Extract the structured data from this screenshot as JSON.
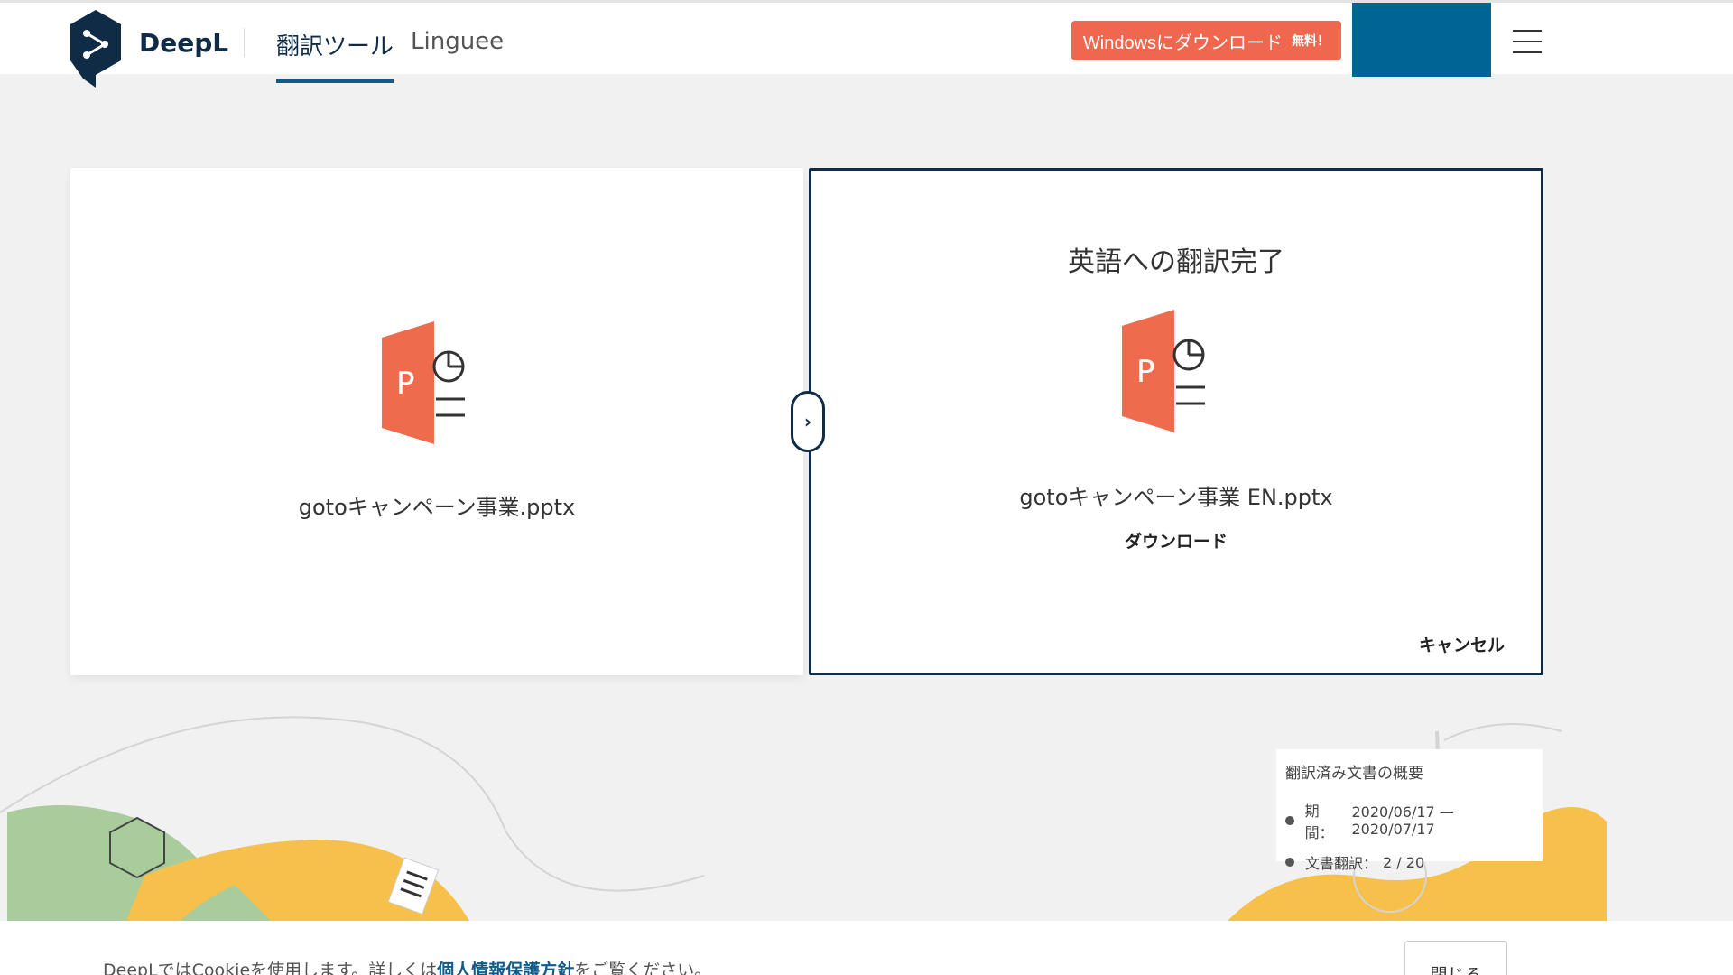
{
  "header": {
    "brand": "DeepL",
    "tabs": [
      {
        "label": "翻訳ツール",
        "active": true
      },
      {
        "label": "Linguee",
        "active": false
      }
    ],
    "download_button": {
      "label": "Windowsにダウンロード",
      "badge": "無料！"
    },
    "menu_icon": "hamburger-icon"
  },
  "source_panel": {
    "file_icon": "powerpoint-icon",
    "filename": "gotoキャンペーン事業.pptx"
  },
  "result_panel": {
    "title": "英語への翻訳完了",
    "file_icon": "powerpoint-icon",
    "filename": "gotoキャンペーン事業 EN.pptx",
    "download_label": "ダウンロード",
    "cancel_label": "キャンセル"
  },
  "toggle": {
    "symbol": "›"
  },
  "summary": {
    "title": "翻訳済み文書の概要",
    "period_label": "期間：",
    "period_value": "2020/06/17 — 2020/07/17",
    "docs_label": "文書翻訳：",
    "docs_value": "2 / 20"
  },
  "cookie": {
    "text_before": "DeepLではCookieを使用します。詳しくは",
    "policy_link": "個人情報保護方針",
    "text_after": "をご覧ください。",
    "close_label": "閉じる"
  },
  "colors": {
    "brand_navy": "#0f2b46",
    "accent_orange": "#f0674f",
    "accent_blue": "#006494",
    "ppt_orange": "#ee6b4d"
  }
}
